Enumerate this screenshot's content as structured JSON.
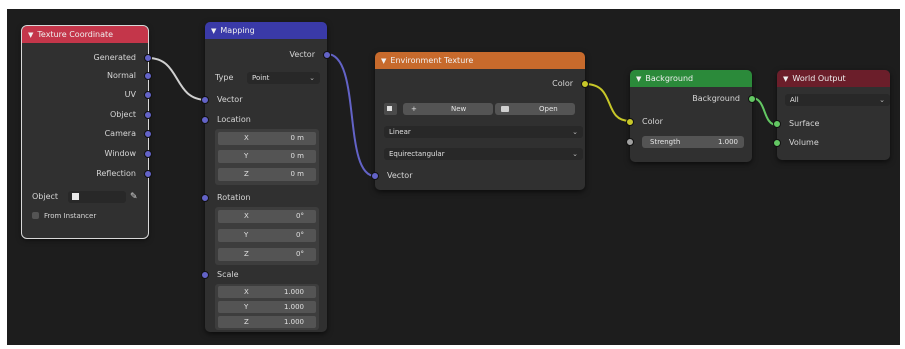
{
  "texcoord": {
    "title": "Texture Coordinate",
    "outputs": [
      "Generated",
      "Normal",
      "UV",
      "Object",
      "Camera",
      "Window",
      "Reflection"
    ],
    "object_label": "Object",
    "from_instancer": "From Instancer"
  },
  "mapping": {
    "title": "Mapping",
    "output": "Vector",
    "type_label": "Type",
    "type_value": "Point",
    "vector_in": "Vector",
    "location": {
      "label": "Location",
      "x": {
        "axis": "X",
        "value": "0 m"
      },
      "y": {
        "axis": "Y",
        "value": "0 m"
      },
      "z": {
        "axis": "Z",
        "value": "0 m"
      }
    },
    "rotation": {
      "label": "Rotation",
      "x": {
        "axis": "X",
        "value": "0°"
      },
      "y": {
        "axis": "Y",
        "value": "0°"
      },
      "z": {
        "axis": "Z",
        "value": "0°"
      }
    },
    "scale": {
      "label": "Scale",
      "x": {
        "axis": "X",
        "value": "1.000"
      },
      "y": {
        "axis": "Y",
        "value": "1.000"
      },
      "z": {
        "axis": "Z",
        "value": "1.000"
      }
    }
  },
  "envtex": {
    "title": "Environment Texture",
    "output": "Color",
    "new_label": "New",
    "open_label": "Open",
    "interpolation": "Linear",
    "projection": "Equirectangular",
    "vector_in": "Vector"
  },
  "background": {
    "title": "Background",
    "output": "Background",
    "color_in": "Color",
    "strength_label": "Strength",
    "strength_value": "1.000"
  },
  "world": {
    "title": "World Output",
    "target": "All",
    "surface": "Surface",
    "volume": "Volume"
  },
  "colors": {
    "canvas": "#1d1d1d",
    "node_body": "#303030",
    "input_header": "#c4364a",
    "vector_header": "#3a3aa8",
    "texture_header": "#c76a2c",
    "shader_header": "#2b8a3a",
    "output_header": "#6b1e2a",
    "link_vector": "#6363c7",
    "link_color": "#c7c729",
    "link_shader": "#63c763"
  }
}
